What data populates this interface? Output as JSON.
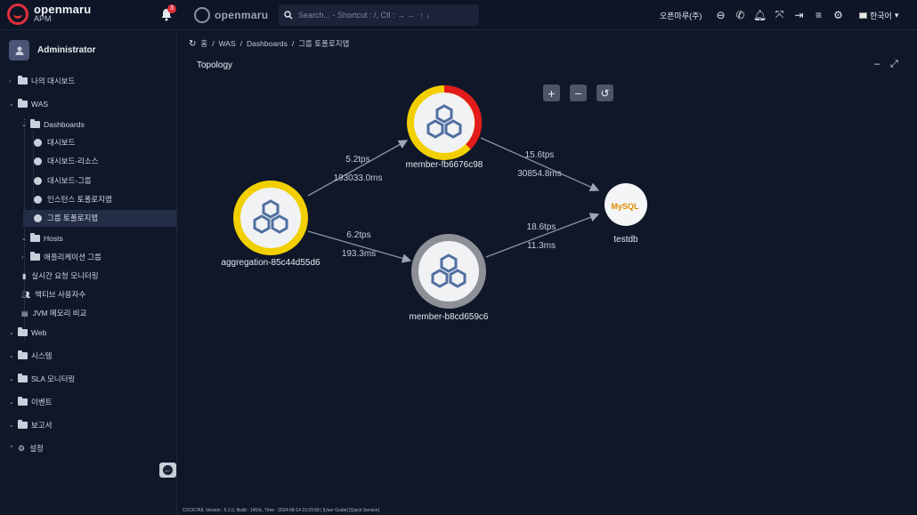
{
  "header": {
    "brand_name": "openmaru",
    "brand_sub": "APM",
    "notification_count": "3",
    "secondary_logo": "openmaru",
    "search_placeholder": "Search... - Shortcut : /, Ctl : → ←  ↑ ↓",
    "org_name": "오픈마루(주)",
    "language": "한국어",
    "icons": [
      "zoom-out-icon",
      "phone-icon",
      "bell-icon",
      "expand-icon",
      "logout-icon",
      "menu-icon",
      "gear-icon"
    ]
  },
  "sidebar": {
    "user": "Administrator",
    "items": [
      {
        "label": "나의 대시보드"
      },
      {
        "label": "WAS"
      },
      {
        "label": "Dashboards"
      },
      {
        "label": "대시보드"
      },
      {
        "label": "대시보드-리소스"
      },
      {
        "label": "대시보드-그룹"
      },
      {
        "label": "인스턴스 토폴로지맵"
      },
      {
        "label": "그룹 토폴로지맵"
      },
      {
        "label": "Hosts"
      },
      {
        "label": "애플리케이션 그룹"
      },
      {
        "label": "실시간 요청 모니터링"
      },
      {
        "label": "액티브 사용자수"
      },
      {
        "label": "JVM 메모리 비교"
      },
      {
        "label": "Web"
      },
      {
        "label": "시스템"
      },
      {
        "label": "SLA 모니터링"
      },
      {
        "label": "이벤트"
      },
      {
        "label": "보고서"
      },
      {
        "label": "설정"
      }
    ]
  },
  "breadcrumb": [
    "홈",
    "WAS",
    "Dashboards",
    "그룹 토폴로지맵"
  ],
  "panel": {
    "title": "Topology"
  },
  "topology": {
    "nodes": [
      {
        "id": "agg",
        "label": "aggregation-85c44d55d6",
        "ring": "#f2cf00"
      },
      {
        "id": "m1",
        "label": "member-fb6676c98",
        "ring": "#f2cf00",
        "alert": "#e21b1b"
      },
      {
        "id": "m2",
        "label": "member-b8cd659c6",
        "ring": "#8d9097"
      },
      {
        "id": "db",
        "label": "testdb",
        "logo": "MySQL"
      }
    ],
    "edges": [
      {
        "tps": "5.2tps",
        "time": "193033.0ms"
      },
      {
        "tps": "6.2tps",
        "time": "193.3ms"
      },
      {
        "tps": "15.6tps",
        "time": "30854.8ms"
      },
      {
        "tps": "18.6tps",
        "time": "11.3ms"
      }
    ]
  },
  "footer": "COCKTAIL Version : 5.1.0, Build : 1453c, Time : 2024-08-14 19:29:59  |  [User Guide]  [Quick Service]"
}
